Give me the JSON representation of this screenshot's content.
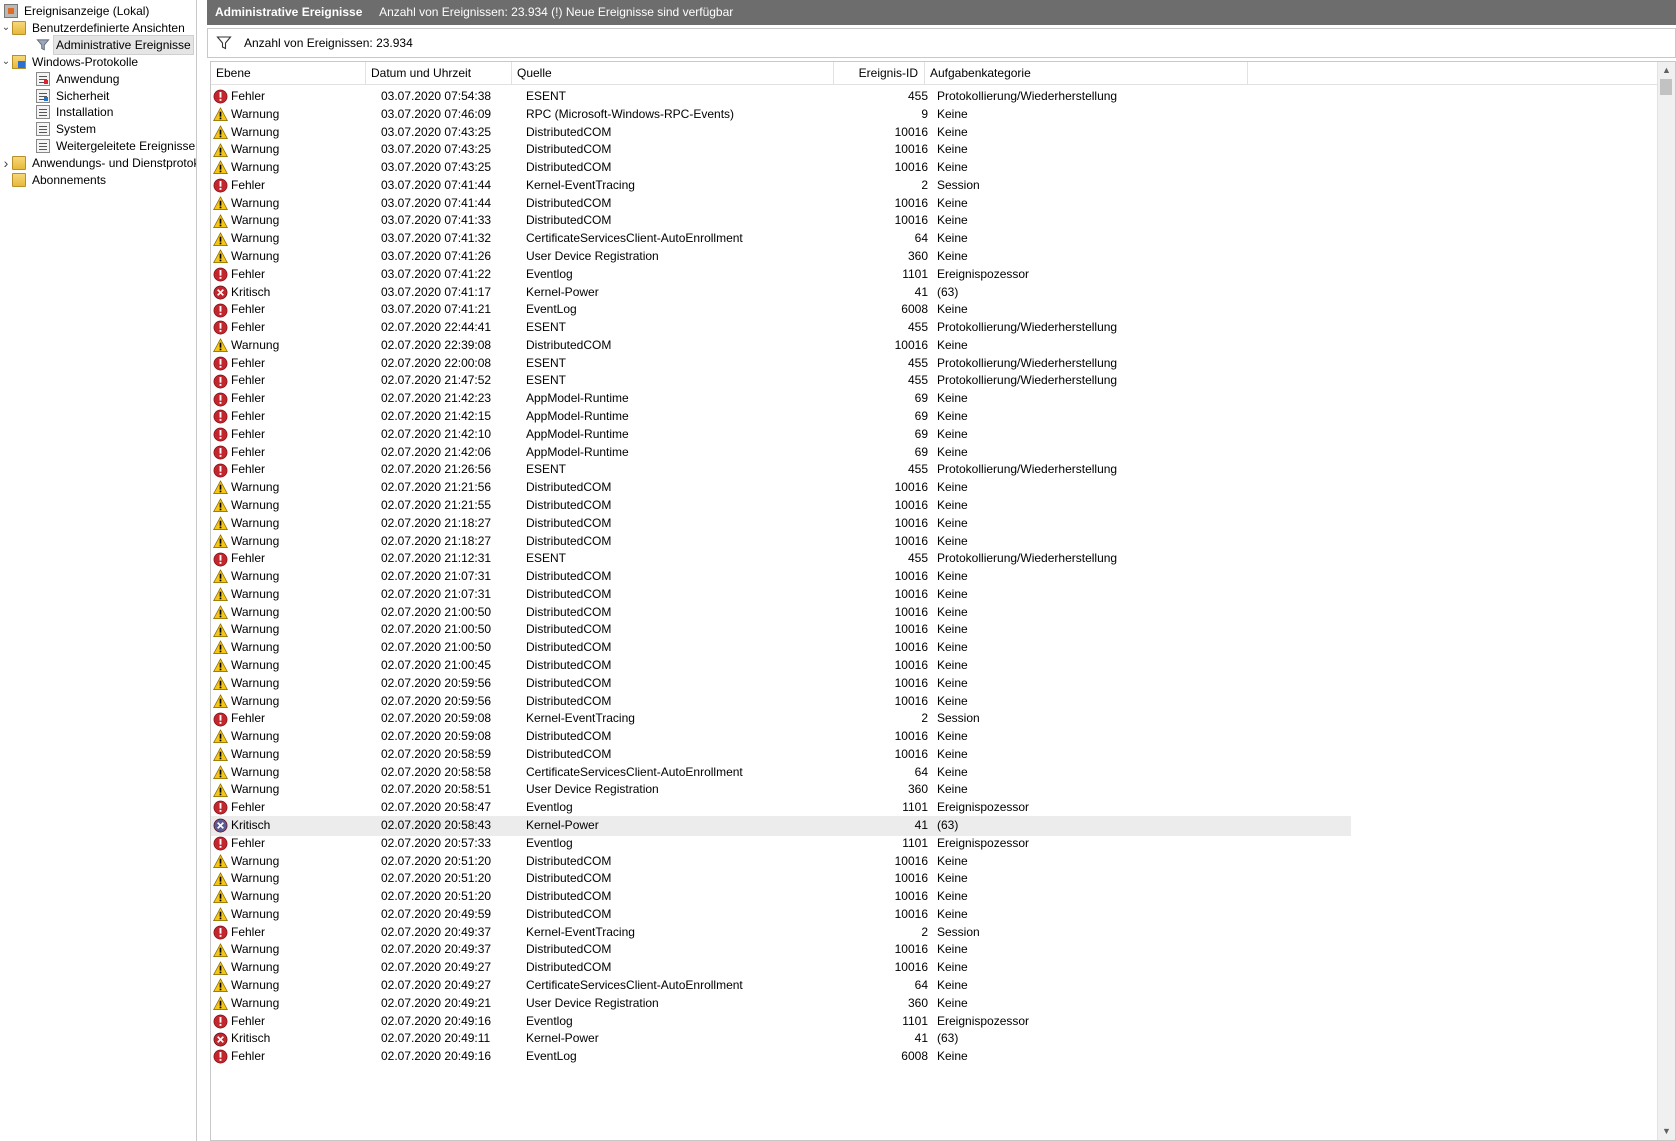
{
  "tree": {
    "items": [
      {
        "label": "Ereignisanzeige (Lokal)",
        "icon": "event-viewer-icon",
        "level": 0,
        "expander": "",
        "kind": "root"
      },
      {
        "label": "Benutzerdefinierte Ansichten",
        "icon": "folder-icon",
        "level": 0,
        "expander": "expanded",
        "kind": "folder"
      },
      {
        "label": "Administrative Ereignisse",
        "icon": "filter-icon",
        "level": 1,
        "expander": "",
        "kind": "filter",
        "selected": true
      },
      {
        "label": "Windows-Protokolle",
        "icon": "folder-icon",
        "level": 0,
        "expander": "expanded",
        "kind": "folder-blue"
      },
      {
        "label": "Anwendung",
        "icon": "log-icon",
        "level": 1,
        "expander": "",
        "kind": "log-red"
      },
      {
        "label": "Sicherheit",
        "icon": "log-icon",
        "level": 1,
        "expander": "",
        "kind": "log-blue"
      },
      {
        "label": "Installation",
        "icon": "log-icon",
        "level": 1,
        "expander": "",
        "kind": "log"
      },
      {
        "label": "System",
        "icon": "log-icon",
        "level": 1,
        "expander": "",
        "kind": "log"
      },
      {
        "label": "Weitergeleitete Ereignisse",
        "icon": "log-icon",
        "level": 1,
        "expander": "",
        "kind": "log"
      },
      {
        "label": "Anwendungs- und Dienstprotokolle",
        "icon": "folder-icon",
        "level": 0,
        "expander": "collapsed",
        "kind": "folder"
      },
      {
        "label": "Abonnements",
        "icon": "folder-icon",
        "level": 0,
        "expander": "",
        "kind": "folder"
      }
    ]
  },
  "header": {
    "title": "Administrative Ereignisse",
    "subtitle": "Anzahl von Ereignissen: 23.934 (!) Neue Ereignisse sind verfügbar"
  },
  "filterbar": {
    "text": "Anzahl von Ereignissen: 23.934"
  },
  "columns": {
    "level": "Ebene",
    "date": "Datum und Uhrzeit",
    "source": "Quelle",
    "id": "Ereignis-ID",
    "category": "Aufgabenkategorie"
  },
  "colors": {
    "error": "#c4262e",
    "warning": "#f5c518",
    "critical": "#c4262e",
    "critical_selected": "#5b5b9a",
    "titlebar": "#6d6d6d"
  },
  "events": [
    {
      "level": "Fehler",
      "type": "error",
      "date": "03.07.2020 07:54:38",
      "source": "ESENT",
      "id": "455",
      "category": "Protokollierung/Wiederherstellung"
    },
    {
      "level": "Warnung",
      "type": "warning",
      "date": "03.07.2020 07:46:09",
      "source": "RPC (Microsoft-Windows-RPC-Events)",
      "id": "9",
      "category": "Keine"
    },
    {
      "level": "Warnung",
      "type": "warning",
      "date": "03.07.2020 07:43:25",
      "source": "DistributedCOM",
      "id": "10016",
      "category": "Keine"
    },
    {
      "level": "Warnung",
      "type": "warning",
      "date": "03.07.2020 07:43:25",
      "source": "DistributedCOM",
      "id": "10016",
      "category": "Keine"
    },
    {
      "level": "Warnung",
      "type": "warning",
      "date": "03.07.2020 07:43:25",
      "source": "DistributedCOM",
      "id": "10016",
      "category": "Keine"
    },
    {
      "level": "Fehler",
      "type": "error",
      "date": "03.07.2020 07:41:44",
      "source": "Kernel-EventTracing",
      "id": "2",
      "category": "Session"
    },
    {
      "level": "Warnung",
      "type": "warning",
      "date": "03.07.2020 07:41:44",
      "source": "DistributedCOM",
      "id": "10016",
      "category": "Keine"
    },
    {
      "level": "Warnung",
      "type": "warning",
      "date": "03.07.2020 07:41:33",
      "source": "DistributedCOM",
      "id": "10016",
      "category": "Keine"
    },
    {
      "level": "Warnung",
      "type": "warning",
      "date": "03.07.2020 07:41:32",
      "source": "CertificateServicesClient-AutoEnrollment",
      "id": "64",
      "category": "Keine"
    },
    {
      "level": "Warnung",
      "type": "warning",
      "date": "03.07.2020 07:41:26",
      "source": "User Device Registration",
      "id": "360",
      "category": "Keine"
    },
    {
      "level": "Fehler",
      "type": "error",
      "date": "03.07.2020 07:41:22",
      "source": "Eventlog",
      "id": "1101",
      "category": "Ereignispozessor"
    },
    {
      "level": "Kritisch",
      "type": "critical",
      "date": "03.07.2020 07:41:17",
      "source": "Kernel-Power",
      "id": "41",
      "category": "(63)"
    },
    {
      "level": "Fehler",
      "type": "error",
      "date": "03.07.2020 07:41:21",
      "source": "EventLog",
      "id": "6008",
      "category": "Keine"
    },
    {
      "level": "Fehler",
      "type": "error",
      "date": "02.07.2020 22:44:41",
      "source": "ESENT",
      "id": "455",
      "category": "Protokollierung/Wiederherstellung"
    },
    {
      "level": "Warnung",
      "type": "warning",
      "date": "02.07.2020 22:39:08",
      "source": "DistributedCOM",
      "id": "10016",
      "category": "Keine"
    },
    {
      "level": "Fehler",
      "type": "error",
      "date": "02.07.2020 22:00:08",
      "source": "ESENT",
      "id": "455",
      "category": "Protokollierung/Wiederherstellung"
    },
    {
      "level": "Fehler",
      "type": "error",
      "date": "02.07.2020 21:47:52",
      "source": "ESENT",
      "id": "455",
      "category": "Protokollierung/Wiederherstellung"
    },
    {
      "level": "Fehler",
      "type": "error",
      "date": "02.07.2020 21:42:23",
      "source": "AppModel-Runtime",
      "id": "69",
      "category": "Keine"
    },
    {
      "level": "Fehler",
      "type": "error",
      "date": "02.07.2020 21:42:15",
      "source": "AppModel-Runtime",
      "id": "69",
      "category": "Keine"
    },
    {
      "level": "Fehler",
      "type": "error",
      "date": "02.07.2020 21:42:10",
      "source": "AppModel-Runtime",
      "id": "69",
      "category": "Keine"
    },
    {
      "level": "Fehler",
      "type": "error",
      "date": "02.07.2020 21:42:06",
      "source": "AppModel-Runtime",
      "id": "69",
      "category": "Keine"
    },
    {
      "level": "Fehler",
      "type": "error",
      "date": "02.07.2020 21:26:56",
      "source": "ESENT",
      "id": "455",
      "category": "Protokollierung/Wiederherstellung"
    },
    {
      "level": "Warnung",
      "type": "warning",
      "date": "02.07.2020 21:21:56",
      "source": "DistributedCOM",
      "id": "10016",
      "category": "Keine"
    },
    {
      "level": "Warnung",
      "type": "warning",
      "date": "02.07.2020 21:21:55",
      "source": "DistributedCOM",
      "id": "10016",
      "category": "Keine"
    },
    {
      "level": "Warnung",
      "type": "warning",
      "date": "02.07.2020 21:18:27",
      "source": "DistributedCOM",
      "id": "10016",
      "category": "Keine"
    },
    {
      "level": "Warnung",
      "type": "warning",
      "date": "02.07.2020 21:18:27",
      "source": "DistributedCOM",
      "id": "10016",
      "category": "Keine"
    },
    {
      "level": "Fehler",
      "type": "error",
      "date": "02.07.2020 21:12:31",
      "source": "ESENT",
      "id": "455",
      "category": "Protokollierung/Wiederherstellung"
    },
    {
      "level": "Warnung",
      "type": "warning",
      "date": "02.07.2020 21:07:31",
      "source": "DistributedCOM",
      "id": "10016",
      "category": "Keine"
    },
    {
      "level": "Warnung",
      "type": "warning",
      "date": "02.07.2020 21:07:31",
      "source": "DistributedCOM",
      "id": "10016",
      "category": "Keine"
    },
    {
      "level": "Warnung",
      "type": "warning",
      "date": "02.07.2020 21:00:50",
      "source": "DistributedCOM",
      "id": "10016",
      "category": "Keine"
    },
    {
      "level": "Warnung",
      "type": "warning",
      "date": "02.07.2020 21:00:50",
      "source": "DistributedCOM",
      "id": "10016",
      "category": "Keine"
    },
    {
      "level": "Warnung",
      "type": "warning",
      "date": "02.07.2020 21:00:50",
      "source": "DistributedCOM",
      "id": "10016",
      "category": "Keine"
    },
    {
      "level": "Warnung",
      "type": "warning",
      "date": "02.07.2020 21:00:45",
      "source": "DistributedCOM",
      "id": "10016",
      "category": "Keine"
    },
    {
      "level": "Warnung",
      "type": "warning",
      "date": "02.07.2020 20:59:56",
      "source": "DistributedCOM",
      "id": "10016",
      "category": "Keine"
    },
    {
      "level": "Warnung",
      "type": "warning",
      "date": "02.07.2020 20:59:56",
      "source": "DistributedCOM",
      "id": "10016",
      "category": "Keine"
    },
    {
      "level": "Fehler",
      "type": "error",
      "date": "02.07.2020 20:59:08",
      "source": "Kernel-EventTracing",
      "id": "2",
      "category": "Session"
    },
    {
      "level": "Warnung",
      "type": "warning",
      "date": "02.07.2020 20:59:08",
      "source": "DistributedCOM",
      "id": "10016",
      "category": "Keine"
    },
    {
      "level": "Warnung",
      "type": "warning",
      "date": "02.07.2020 20:58:59",
      "source": "DistributedCOM",
      "id": "10016",
      "category": "Keine"
    },
    {
      "level": "Warnung",
      "type": "warning",
      "date": "02.07.2020 20:58:58",
      "source": "CertificateServicesClient-AutoEnrollment",
      "id": "64",
      "category": "Keine"
    },
    {
      "level": "Warnung",
      "type": "warning",
      "date": "02.07.2020 20:58:51",
      "source": "User Device Registration",
      "id": "360",
      "category": "Keine"
    },
    {
      "level": "Fehler",
      "type": "error",
      "date": "02.07.2020 20:58:47",
      "source": "Eventlog",
      "id": "1101",
      "category": "Ereignispozessor"
    },
    {
      "level": "Kritisch",
      "type": "critical",
      "date": "02.07.2020 20:58:43",
      "source": "Kernel-Power",
      "id": "41",
      "category": "(63)",
      "highlighted": true
    },
    {
      "level": "Fehler",
      "type": "error",
      "date": "02.07.2020 20:57:33",
      "source": "Eventlog",
      "id": "1101",
      "category": "Ereignispozessor"
    },
    {
      "level": "Warnung",
      "type": "warning",
      "date": "02.07.2020 20:51:20",
      "source": "DistributedCOM",
      "id": "10016",
      "category": "Keine"
    },
    {
      "level": "Warnung",
      "type": "warning",
      "date": "02.07.2020 20:51:20",
      "source": "DistributedCOM",
      "id": "10016",
      "category": "Keine"
    },
    {
      "level": "Warnung",
      "type": "warning",
      "date": "02.07.2020 20:51:20",
      "source": "DistributedCOM",
      "id": "10016",
      "category": "Keine"
    },
    {
      "level": "Warnung",
      "type": "warning",
      "date": "02.07.2020 20:49:59",
      "source": "DistributedCOM",
      "id": "10016",
      "category": "Keine"
    },
    {
      "level": "Fehler",
      "type": "error",
      "date": "02.07.2020 20:49:37",
      "source": "Kernel-EventTracing",
      "id": "2",
      "category": "Session"
    },
    {
      "level": "Warnung",
      "type": "warning",
      "date": "02.07.2020 20:49:37",
      "source": "DistributedCOM",
      "id": "10016",
      "category": "Keine"
    },
    {
      "level": "Warnung",
      "type": "warning",
      "date": "02.07.2020 20:49:27",
      "source": "DistributedCOM",
      "id": "10016",
      "category": "Keine"
    },
    {
      "level": "Warnung",
      "type": "warning",
      "date": "02.07.2020 20:49:27",
      "source": "CertificateServicesClient-AutoEnrollment",
      "id": "64",
      "category": "Keine"
    },
    {
      "level": "Warnung",
      "type": "warning",
      "date": "02.07.2020 20:49:21",
      "source": "User Device Registration",
      "id": "360",
      "category": "Keine"
    },
    {
      "level": "Fehler",
      "type": "error",
      "date": "02.07.2020 20:49:16",
      "source": "Eventlog",
      "id": "1101",
      "category": "Ereignispozessor"
    },
    {
      "level": "Kritisch",
      "type": "critical",
      "date": "02.07.2020 20:49:11",
      "source": "Kernel-Power",
      "id": "41",
      "category": "(63)"
    },
    {
      "level": "Fehler",
      "type": "error",
      "date": "02.07.2020 20:49:16",
      "source": "EventLog",
      "id": "6008",
      "category": "Keine"
    }
  ]
}
